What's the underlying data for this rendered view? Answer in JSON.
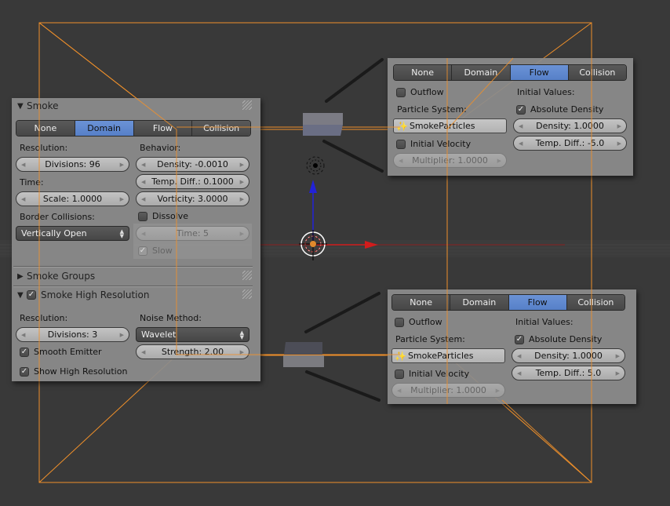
{
  "viewport": {
    "colors": {
      "background": "#393939",
      "selection_outline": "#f0902a",
      "axis_x": "#d21c1c",
      "axis_z": "#2222d8",
      "emitter_top": "#7b7b84",
      "emitter_front": "#6a6e84"
    }
  },
  "domain_panel": {
    "smoke_header": "Smoke",
    "tabs": [
      "None",
      "Domain",
      "Flow",
      "Collision"
    ],
    "active_tab": "Domain",
    "resolution_label": "Resolution:",
    "divisions": "Divisions: 96",
    "time_label": "Time:",
    "scale": "Scale: 1.0000",
    "border_collisions_label": "Border Collisions:",
    "border_collisions_value": "Vertically Open",
    "behavior_label": "Behavior:",
    "density": "Density: -0.0010",
    "temp_diff": "Temp. Diff.: 0.1000",
    "vorticity": "Vorticity: 3.0000",
    "dissolve_label": "Dissolve",
    "dissolve_checked": false,
    "time_value": "Time: 5",
    "slow_label": "Slow",
    "slow_checked": true,
    "smoke_groups_header": "Smoke Groups",
    "high_res_header": "Smoke High Resolution",
    "high_res_checked": true,
    "hr_resolution_label": "Resolution:",
    "hr_divisions": "Divisions: 3",
    "smooth_emitter_label": "Smooth Emitter",
    "smooth_emitter_checked": true,
    "show_high_res_label": "Show High Resolution",
    "show_high_res_checked": true,
    "noise_method_label": "Noise Method:",
    "noise_method_value": "Wavelet",
    "strength": "Strength: 2.00"
  },
  "flow_panel_top": {
    "tabs": [
      "None",
      "Domain",
      "Flow",
      "Collision"
    ],
    "active_tab": "Flow",
    "outflow_label": "Outflow",
    "outflow_checked": false,
    "particle_system_label": "Particle System:",
    "particle_system_value": "SmokeParticles",
    "initial_velocity_label": "Initial Velocity",
    "initial_velocity_checked": false,
    "multiplier": "Multiplier: 1.0000",
    "initial_values_label": "Initial Values:",
    "absolute_density_label": "Absolute Density",
    "absolute_density_checked": true,
    "density": "Density: 1.0000",
    "temp_diff": "Temp. Diff.: -5.0"
  },
  "flow_panel_bottom": {
    "tabs": [
      "None",
      "Domain",
      "Flow",
      "Collision"
    ],
    "active_tab": "Flow",
    "outflow_label": "Outflow",
    "outflow_checked": false,
    "particle_system_label": "Particle System:",
    "particle_system_value": "SmokeParticles",
    "initial_velocity_label": "Initial Velocity",
    "initial_velocity_checked": false,
    "multiplier": "Multiplier: 1.0000",
    "initial_values_label": "Initial Values:",
    "absolute_density_label": "Absolute Density",
    "absolute_density_checked": true,
    "density": "Density: 1.0000",
    "temp_diff": "Temp. Diff.: 5.0"
  }
}
